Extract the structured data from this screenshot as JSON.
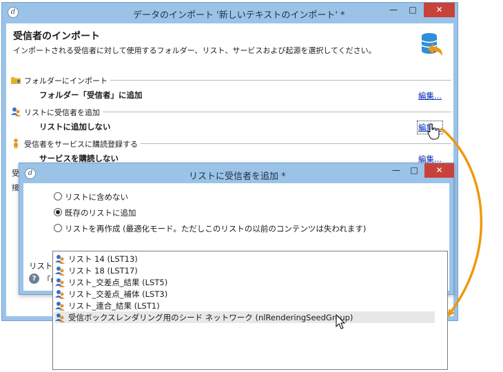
{
  "window1": {
    "title": "データのインポート '新しいテキストのインポート' *",
    "header_title": "受信者のインポート",
    "header_subtitle": "インポートされる受信者に対して使用するフォルダー、リスト、サービスおよび起源を選択してください。",
    "sections": [
      {
        "label": "フォルダーにインポート",
        "value": "フォルダー「受信者」に追加",
        "edit": "編集..."
      },
      {
        "label": "リストに受信者を追加",
        "value": "リストに追加しない",
        "edit": "編集..."
      },
      {
        "label": "受信者をサービスに購読登録する",
        "value": "サービスを購読しない",
        "edit": "編集..."
      }
    ],
    "side_texts": [
      "受",
      "接"
    ],
    "close_glyph": "✕",
    "maximize_glyph": "□",
    "minimize_glyph": "—"
  },
  "window2": {
    "title": "リストに受信者を追加 *",
    "radios": [
      {
        "label": "リストに含めない",
        "checked": false
      },
      {
        "label": "既存のリストに追加",
        "checked": true
      },
      {
        "label": "リストを再作成 (最適化モード。ただしこのリストの以前のコンテンツは失われます)",
        "checked": false
      }
    ],
    "list_label": "リスト:",
    "info_text": "「n",
    "close_glyph": "✕",
    "maximize_glyph": "□",
    "minimize_glyph": "—"
  },
  "dropdown": {
    "items": [
      "リスト 14 (LST13)",
      "リスト 18 (LST17)",
      "リスト_交差点_結果 (LST5)",
      "リスト_交差点_補体 (LST3)",
      "リスト_連合_結果 (LST1)",
      "受信ボックスレンダリング用のシード ネットワーク (nlRenderingSeedGroup)"
    ],
    "highlighted_index": 5
  },
  "colors": {
    "titlebar": "#9bc3e8",
    "close": "#c9423a",
    "link": "#0a2fb8",
    "arrow": "#f0980f"
  }
}
